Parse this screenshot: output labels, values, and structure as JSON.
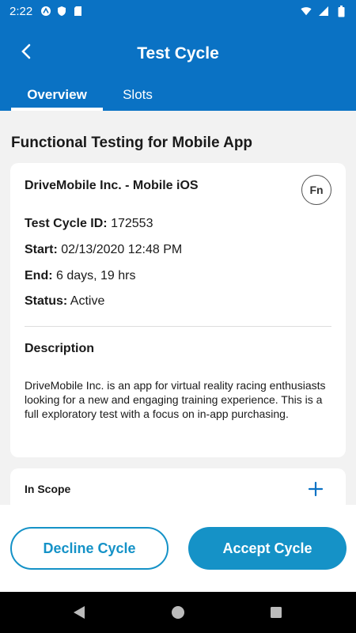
{
  "status_bar": {
    "time": "2:22"
  },
  "app_bar": {
    "title": "Test Cycle"
  },
  "tabs": [
    {
      "label": "Overview"
    },
    {
      "label": "Slots"
    }
  ],
  "section_title": "Functional Testing for Mobile App",
  "cycle": {
    "company": "DriveMobile Inc. - Mobile iOS",
    "badge": "Fn",
    "id_label": "Test Cycle ID:",
    "id_value": "172553",
    "start_label": "Start:",
    "start_value": "02/13/2020 12:48 PM",
    "end_label": "End:",
    "end_value": "6 days, 19 hrs",
    "status_label": "Status:",
    "status_value": "Active",
    "description_heading": "Description",
    "description": "DriveMobile Inc. is an app for virtual reality racing enthusiasts looking for a new and engaging training experience. This is a full exploratory test with a focus on in-app purchasing."
  },
  "scope": {
    "label": "In Scope"
  },
  "actions": {
    "decline": "Decline Cycle",
    "accept": "Accept Cycle"
  },
  "colors": {
    "primary": "#0a72c4",
    "accent": "#1592c7",
    "background": "#f2f2f2"
  }
}
